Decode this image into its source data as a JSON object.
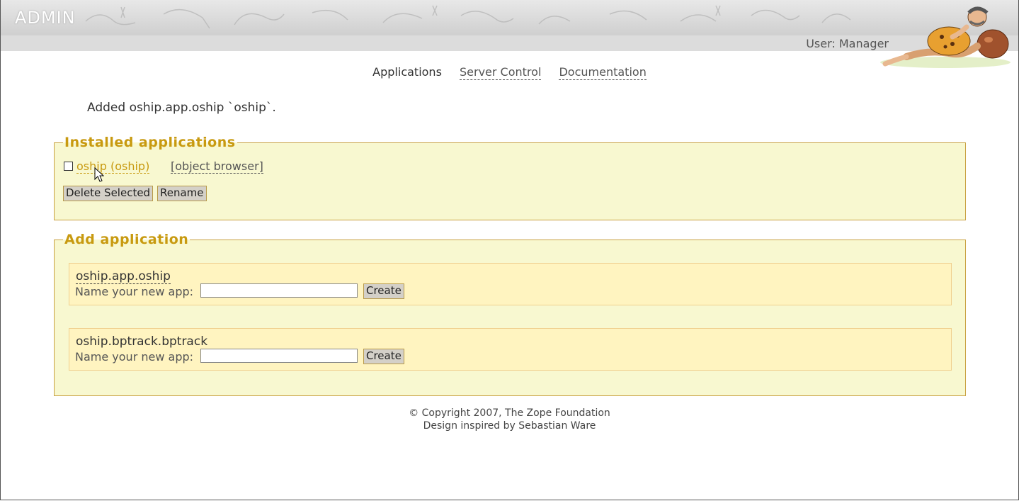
{
  "header": {
    "logo_text": "ADMIN",
    "user_label": "User: Manager"
  },
  "nav": {
    "items": [
      {
        "label": "Applications",
        "active": true
      },
      {
        "label": "Server Control",
        "active": false
      },
      {
        "label": "Documentation",
        "active": false
      }
    ]
  },
  "message": "Added oship.app.oship `oship`.",
  "installed": {
    "legend": "Installed applications",
    "apps": [
      {
        "name": "oship (oship)",
        "object_browser": "[object browser]",
        "checked": false
      }
    ],
    "delete_label": "Delete Selected",
    "rename_label": "Rename"
  },
  "add": {
    "legend": "Add application",
    "items": [
      {
        "title": "oship.app.oship",
        "name_label": "Name your new app:",
        "value": "",
        "create_label": "Create"
      },
      {
        "title": "oship.bptrack.bptrack",
        "name_label": "Name your new app:",
        "value": "",
        "create_label": "Create"
      }
    ]
  },
  "footer": {
    "copyright": "© Copyright 2007, The Zope Foundation",
    "credit": "Design inspired by Sebastian Ware"
  },
  "colors": {
    "accent": "#c89a10",
    "panel_bg": "#f8f8d0",
    "card_bg": "#fff4c0"
  }
}
